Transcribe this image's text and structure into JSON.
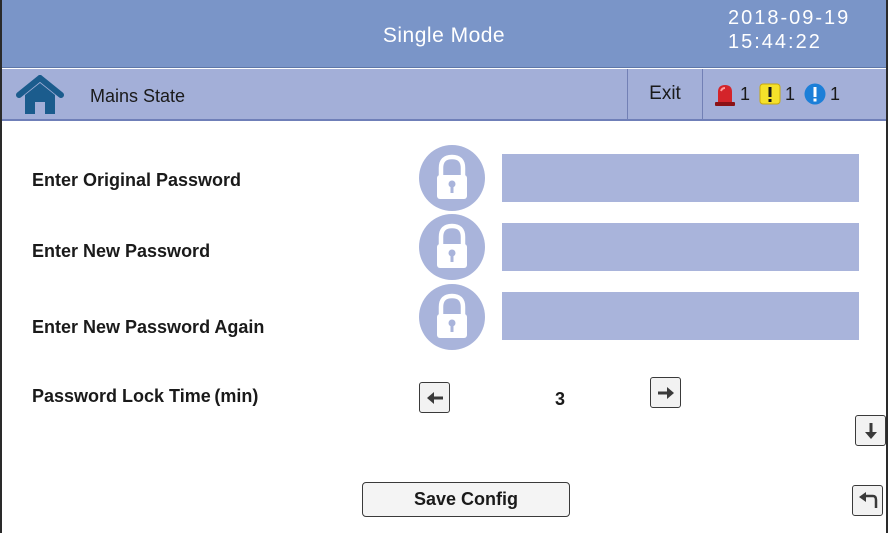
{
  "header": {
    "title": "Single Mode",
    "date": "2018-09-19",
    "time": "15:44:22"
  },
  "statusbar": {
    "state_label": "Mains State",
    "exit_label": "Exit",
    "alarms": [
      {
        "icon": "red-alarm-icon",
        "count": "1"
      },
      {
        "icon": "yellow-warning-icon",
        "count": "1"
      },
      {
        "icon": "blue-info-icon",
        "count": "1"
      }
    ]
  },
  "form": {
    "original_password_label": "Enter Original Password",
    "new_password_label": "Enter New Password",
    "new_password_again_label": "Enter New Password Again",
    "original_password_value": "",
    "new_password_value": "",
    "new_password_again_value": "",
    "lock_time_label": "Password Lock Time (min)",
    "lock_time_value": "3"
  },
  "actions": {
    "save_label": "Save Config"
  },
  "colors": {
    "title_bar": "#7a95c8",
    "status_bar": "#a3afd8",
    "field": "#a9b4db",
    "alarm_red": "#d4242a",
    "warning_yellow": "#f5e12a",
    "info_blue": "#1c7fd8",
    "home_icon": "#1b5c8d"
  }
}
